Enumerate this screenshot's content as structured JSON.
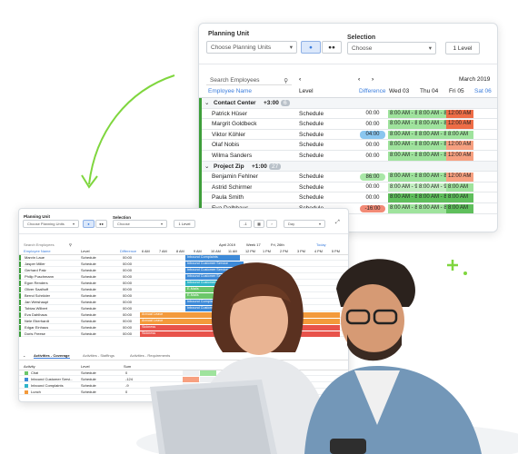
{
  "colors": {
    "accent": "#3b7ddd",
    "green": "#3e9e3a",
    "shift_green": "#9fe39d",
    "shift_red": "#ee6d47",
    "highlight": "#8ac6ef"
  },
  "big": {
    "planning_unit_label": "Planning Unit",
    "planning_unit_placeholder": "Choose Planning Units",
    "selection_label": "Selection",
    "selection_placeholder": "Choose",
    "level_button": "1 Level",
    "search_placeholder": "Search Employees",
    "col_employee_name": "Employee Name",
    "col_level": "Level",
    "col_difference": "Difference",
    "month": "March 2019",
    "days": [
      "Wed 03",
      "Thu 04",
      "Fri 05",
      "Sat 06"
    ],
    "rows": [
      {
        "type": "group",
        "name": "Contact Center",
        "count": "+3:00",
        "badge": "6"
      },
      {
        "type": "emp",
        "name": "Patrick Hüser",
        "level": "Schedule",
        "diff": "00:00",
        "shifts": [
          [
            "8:00 AM - 8:00 A",
            "g"
          ],
          [
            "8:00 AM - 8:00 A",
            "g"
          ],
          [
            "12:00 AM",
            "r"
          ]
        ]
      },
      {
        "type": "emp",
        "name": "Margrit Goldbeck",
        "level": "Schedule",
        "diff": "00:00",
        "shifts": [
          [
            "8:00 AM - 8:00 A",
            "g"
          ],
          [
            "8:00 AM - 8:00 A",
            "g"
          ],
          [
            "12:00 AM",
            "r"
          ]
        ]
      },
      {
        "type": "emp",
        "name": "Viktor Köhler",
        "level": "Schedule",
        "diff": "04:00",
        "diffhl": "b",
        "shifts": [
          [
            "8:00 AM - 8:00 A",
            "g"
          ],
          [
            "8:00 AM - 8:00 A",
            "g"
          ],
          [
            "8:00 AM",
            "g"
          ]
        ]
      },
      {
        "type": "emp",
        "name": "Olaf Nobis",
        "level": "Schedule",
        "diff": "00:00",
        "shifts": [
          [
            "8:00 AM - 8:00 A",
            "g"
          ],
          [
            "8:00 AM - 8:00 A",
            "g"
          ],
          [
            "12:00 AM",
            "o"
          ]
        ]
      },
      {
        "type": "emp",
        "name": "Wilma Sanders",
        "level": "Schedule",
        "diff": "00:00",
        "shifts": [
          [
            "8:00 AM - 8:00 A",
            "g"
          ],
          [
            "8:00 AM - 8:00 A",
            "g"
          ],
          [
            "12:00 AM",
            "o"
          ]
        ]
      },
      {
        "type": "group",
        "name": "Project Zip",
        "count": "+1:00",
        "badge": "27"
      },
      {
        "type": "emp",
        "name": "Benjamin Fehlner",
        "level": "Schedule",
        "diff": "86:00",
        "diffhl": "g",
        "shifts": [
          [
            "8:00 AM - 8:00 A",
            "g"
          ],
          [
            "8:00 AM - 8:00 A",
            "g"
          ],
          [
            "12:00 AM",
            "o"
          ]
        ]
      },
      {
        "type": "emp",
        "name": "Astrid Schirmer",
        "level": "Schedule",
        "diff": "00:00",
        "shifts": [
          [
            "8:00 AM - 9:30 A",
            "gl"
          ],
          [
            "8:00 AM - 9:30 A",
            "gl"
          ],
          [
            "8:00 AM",
            "g"
          ]
        ]
      },
      {
        "type": "emp",
        "name": "Paula Smith",
        "level": "Schedule",
        "diff": "00:00",
        "shifts": [
          [
            "8:00 AM - 8:00 A",
            "gd"
          ],
          [
            "8:00 AM - 8:00 A",
            "gd"
          ],
          [
            "8:00 AM",
            "gd"
          ]
        ]
      },
      {
        "type": "emp",
        "name": "Eva Dalhhaus",
        "level": "Schedule",
        "diff": "-16:00",
        "diffhl": "r",
        "shifts": [
          [
            "8:00 AM - 8:00 A",
            "g"
          ],
          [
            "8:00 AM - 8:00 A",
            "g"
          ],
          [
            "8:00 AM",
            "gd"
          ]
        ]
      }
    ]
  },
  "small": {
    "planning_unit_label": "Planning Unit",
    "planning_unit_placeholder": "Choose Planning Units",
    "selection_label": "Selection",
    "selection_placeholder": "Choose",
    "level_button": "1 Level",
    "step_value": "-1",
    "view_select": "Day",
    "search_placeholder": "Search Employees",
    "col_employee_name": "Employee Name",
    "col_level": "Level",
    "col_difference": "Difference",
    "date_header": [
      "April 2019",
      "Week 17",
      "Fri, 26th"
    ],
    "today": "Today",
    "hours": [
      "6 AM",
      "7 AM",
      "8 AM",
      "9 AM",
      "10 AM",
      "11 AM",
      "12 PM",
      "1 PM",
      "2 PM",
      "3 PM",
      "4 PM",
      "5 PM"
    ],
    "employees": [
      [
        "Marvin Laue",
        "Schedule",
        "00:00"
      ],
      [
        "Jasper Miller",
        "Schedule",
        "00:00"
      ],
      [
        "Gerhard Patz",
        "Schedule",
        "00:00"
      ],
      [
        "Philip Puschmann",
        "Schedule",
        "00:00"
      ],
      [
        "Egon Renders",
        "Schedule",
        "00:00"
      ],
      [
        "Oliver Saalhoff",
        "Schedule",
        "00:00"
      ],
      [
        "Bernd Schröder",
        "Schedule",
        "00:00"
      ],
      [
        "Jan Weishaupt",
        "Schedule",
        "00:00"
      ],
      [
        "Tobias Wilbert",
        "Schedule",
        "00:00"
      ],
      [
        "Eva Dahlhaus",
        "Schedule",
        "00:00"
      ],
      [
        "Nele Eberhardt",
        "Schedule",
        "00:00"
      ],
      [
        "Edgar Einhaus",
        "Schedule",
        "00:00"
      ],
      [
        "Doris Freese",
        "Schedule",
        "00:00"
      ]
    ],
    "bars": [
      [
        "Inbound Complaints",
        "blue"
      ],
      [
        "Inbound Customer Service",
        "blue"
      ],
      [
        "Inbound Customer Service",
        "blue"
      ],
      [
        "Inbound Customer Service",
        "blue"
      ],
      [
        "Inbound Customer Service",
        "teal"
      ],
      [
        "E-Mails",
        "lgreen"
      ],
      [
        "E-Mails",
        "lgreen"
      ],
      [
        "Inbound Complaints",
        "blue"
      ],
      [
        "Inbound Customer Service",
        "blue"
      ],
      [
        "Annual Leave",
        "orange"
      ],
      [
        "Annual Leave",
        "orange"
      ],
      [
        "Sickness",
        "red"
      ],
      [
        "Sickness",
        "red"
      ]
    ],
    "tabs": [
      "Activities - Coverage",
      "Activities - Staffings",
      "Activities - Requirements"
    ],
    "act_cols": [
      "Activity",
      "Level",
      "Sum"
    ],
    "activities": [
      [
        "Chat",
        "Schedule",
        "0"
      ],
      [
        "Inbound Customer Servi...",
        "Schedule",
        "-124"
      ],
      [
        "Inbound Complaints",
        "Schedule",
        "-9"
      ],
      [
        "Lunch",
        "Schedule",
        "0"
      ]
    ]
  }
}
